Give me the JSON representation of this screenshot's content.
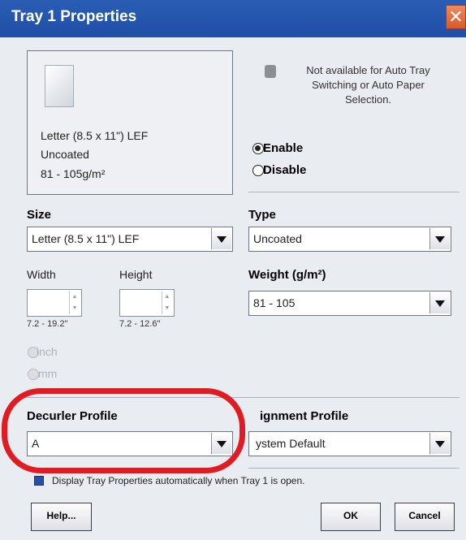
{
  "window": {
    "title": "Tray 1 Properties",
    "close_glyph": "✕"
  },
  "preview": {
    "size_line": "Letter (8.5 x 11\") LEF",
    "type_line": "Uncoated",
    "weight_line": "81 - 105g/m²"
  },
  "notice": {
    "text": "Not available for Auto Tray Switching or Auto Paper Selection.",
    "icon": "info-icon"
  },
  "state": {
    "enable_label": "Enable",
    "disable_label": "Disable",
    "selected": "Enable"
  },
  "size": {
    "label": "Size",
    "value": "Letter (8.5 x 11\") LEF"
  },
  "type": {
    "label": "Type",
    "value": "Uncoated"
  },
  "dimensions": {
    "width_label": "Width",
    "height_label": "Height",
    "width_range": "7.2 - 19.2\"",
    "height_range": "7.2 - 12.6\""
  },
  "weight": {
    "label": "Weight (g/m²)",
    "value": "81 - 105"
  },
  "units": {
    "inch_label": "inch",
    "mm_label": "mm"
  },
  "decurler": {
    "label": "Decurler Profile",
    "value": "A"
  },
  "alignment": {
    "label_visible": "ignment Profile",
    "value_visible": "ystem Default"
  },
  "auto_display": {
    "text": "Display Tray Properties automatically when Tray 1 is open.",
    "checked": true
  },
  "buttons": {
    "help": "Help...",
    "ok": "OK",
    "cancel": "Cancel"
  },
  "colors": {
    "titlebar": "#2b5db4",
    "annotation": "#e21b22"
  }
}
